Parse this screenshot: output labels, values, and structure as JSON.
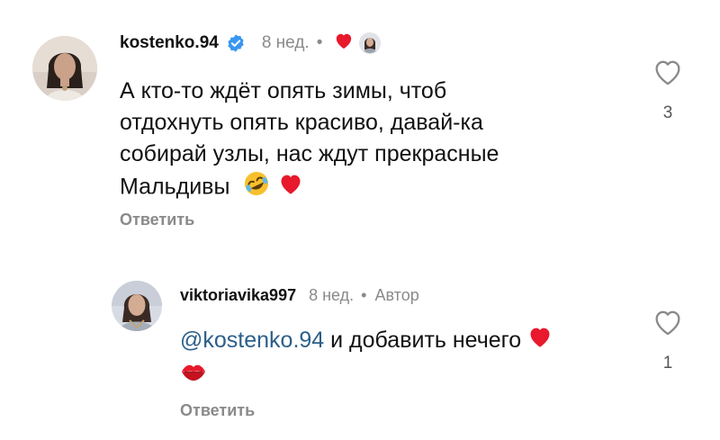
{
  "comments": [
    {
      "username": "kostenko.94",
      "verified": true,
      "time": "8 нед.",
      "separator": "•",
      "text_lines": [
        "А кто-то ждёт опять зимы, чтоб",
        "отдохнуть опять красиво, давай-ка",
        "собирай узлы, нас ждут прекрасные",
        "Мальдивы"
      ],
      "text_emojis": [
        "rolling-on-floor-laughing-emoji",
        "red-heart-emoji"
      ],
      "reply_label": "Ответить",
      "like_count": "3",
      "liked_by_author": true
    },
    {
      "username": "viktoriavika997",
      "time": "8 нед.",
      "separator": "•",
      "author_label": "Автор",
      "mention": "@kostenko.94",
      "text": " и добавить нечего",
      "text_emojis": [
        "red-heart-emoji",
        "kiss-mark-emoji"
      ],
      "reply_label": "Ответить",
      "like_count": "1"
    }
  ],
  "colors": {
    "text": "#111111",
    "secondary": "#8a8a8a",
    "mention": "#2b5f8a",
    "verified_badge": "#3897f0",
    "heart_red": "#e8192c"
  },
  "icons": {
    "like": "heart-outline-icon",
    "verified": "verified-badge-icon",
    "creator_liked": "red-heart-icon"
  }
}
